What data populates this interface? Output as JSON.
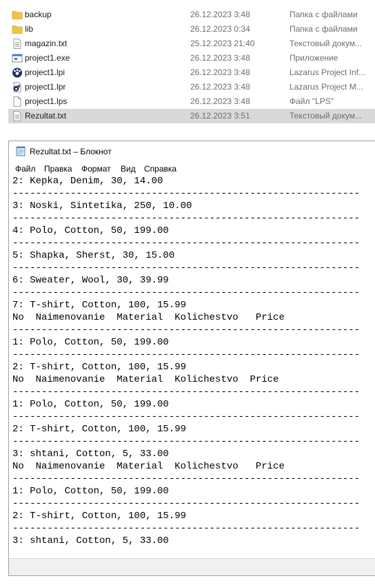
{
  "explorer": {
    "files": [
      {
        "name": "backup",
        "date": "26.12.2023 3:48",
        "type": "Папка с файлами",
        "icon": "folder-icon"
      },
      {
        "name": "lib",
        "date": "26.12.2023 0:34",
        "type": "Папка с файлами",
        "icon": "folder-icon"
      },
      {
        "name": "magazin.txt",
        "date": "25.12.2023 21:40",
        "type": "Текстовый докум...",
        "icon": "text-file-icon"
      },
      {
        "name": "project1.exe",
        "date": "26.12.2023 3:48",
        "type": "Приложение",
        "icon": "exe-icon"
      },
      {
        "name": "project1.lpi",
        "date": "26.12.2023 3:48",
        "type": "Lazarus Project Inf...",
        "icon": "lazarus-lpi-icon"
      },
      {
        "name": "project1.lpr",
        "date": "26.12.2023 3:48",
        "type": "Lazarus Project M...",
        "icon": "lazarus-lpr-icon"
      },
      {
        "name": "project1.lps",
        "date": "26.12.2023 3:48",
        "type": "Файл \"LPS\"",
        "icon": "blank-file-icon"
      },
      {
        "name": "Rezultat.txt",
        "date": "26.12.2023 3:51",
        "type": "Текстовый докум...",
        "icon": "text-file-icon",
        "selected": true
      }
    ]
  },
  "notepad": {
    "title": "Rezultat.txt – Блокнот",
    "menu": [
      "Файл",
      "Правка",
      "Формат",
      "Вид",
      "Справка"
    ],
    "lines": [
      "2: Kepka, Denim, 30, 14.00",
      "------------------------------------------------------------",
      "3: Noski, Sintetika, 250, 10.00",
      "------------------------------------------------------------",
      "4: Polo, Cotton, 50, 199.00",
      "------------------------------------------------------------",
      "5: Shapka, Sherst, 30, 15.00",
      "------------------------------------------------------------",
      "6: Sweater, Wool, 30, 39.99",
      "------------------------------------------------------------",
      "7: T-shirt, Cotton, 100, 15.99",
      "No  Naimenovanie  Material  Kolichestvo   Price",
      "------------------------------------------------------------",
      "1: Polo, Cotton, 50, 199.00",
      "------------------------------------------------------------",
      "2: T-shirt, Cotton, 100, 15.99",
      "No  Naimenovanie  Material  Kolichestvo  Price",
      "------------------------------------------------------------",
      "1: Polo, Cotton, 50, 199.00",
      "------------------------------------------------------------",
      "2: T-shirt, Cotton, 100, 15.99",
      "------------------------------------------------------------",
      "3: shtani, Cotton, 5, 33.00",
      "No  Naimenovanie  Material  Kolichestvo   Price",
      "------------------------------------------------------------",
      "1: Polo, Cotton, 50, 199.00",
      "------------------------------------------------------------",
      "2: T-shirt, Cotton, 100, 15.99",
      "------------------------------------------------------------",
      "3: shtani, Cotton, 5, 33.00"
    ]
  },
  "colors": {
    "selected_row": "#d9d9d9",
    "folder": "#f5c342",
    "secondary_text": "#6d6d6d",
    "statusbar": "#f0f0f0"
  }
}
